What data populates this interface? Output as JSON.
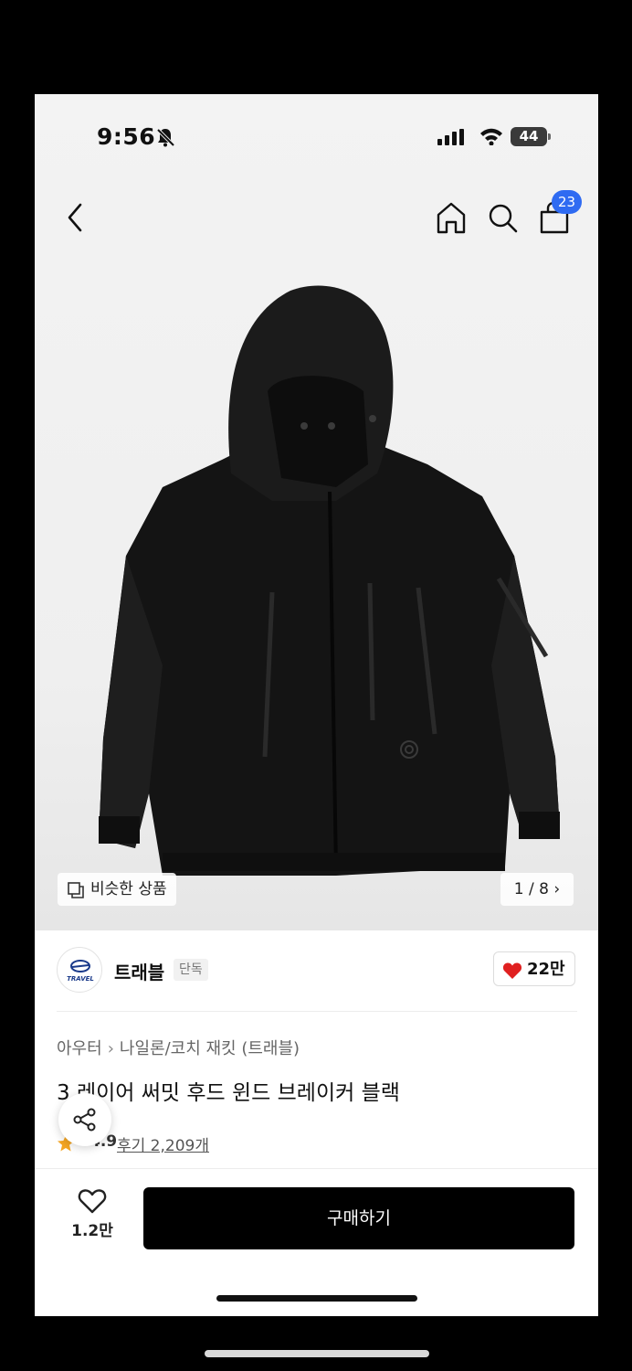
{
  "status_bar": {
    "time": "9:56",
    "battery": "44"
  },
  "nav": {
    "cart_count": "23"
  },
  "gallery": {
    "similar_label": "비슷한 상품",
    "pager": "1 / 8"
  },
  "brand": {
    "name": "트래블",
    "logo_text": "TRAVEL",
    "exclusive_tag": "단독",
    "likes": "22만"
  },
  "product": {
    "category_1": "아우터",
    "category_2": "나일론/코치 재킷 (트래블)",
    "title": "3 레이어 써밋 후드 윈드 브레이커 블랙",
    "rating": "4.9",
    "reviews": "후기 2,209개"
  },
  "bottom_bar": {
    "wish_count": "1.2만",
    "buy_label": "구매하기"
  },
  "colors": {
    "badge": "#2f6bf2",
    "heart": "#e02020",
    "star": "#f5a623",
    "buy_button": "#000000"
  }
}
